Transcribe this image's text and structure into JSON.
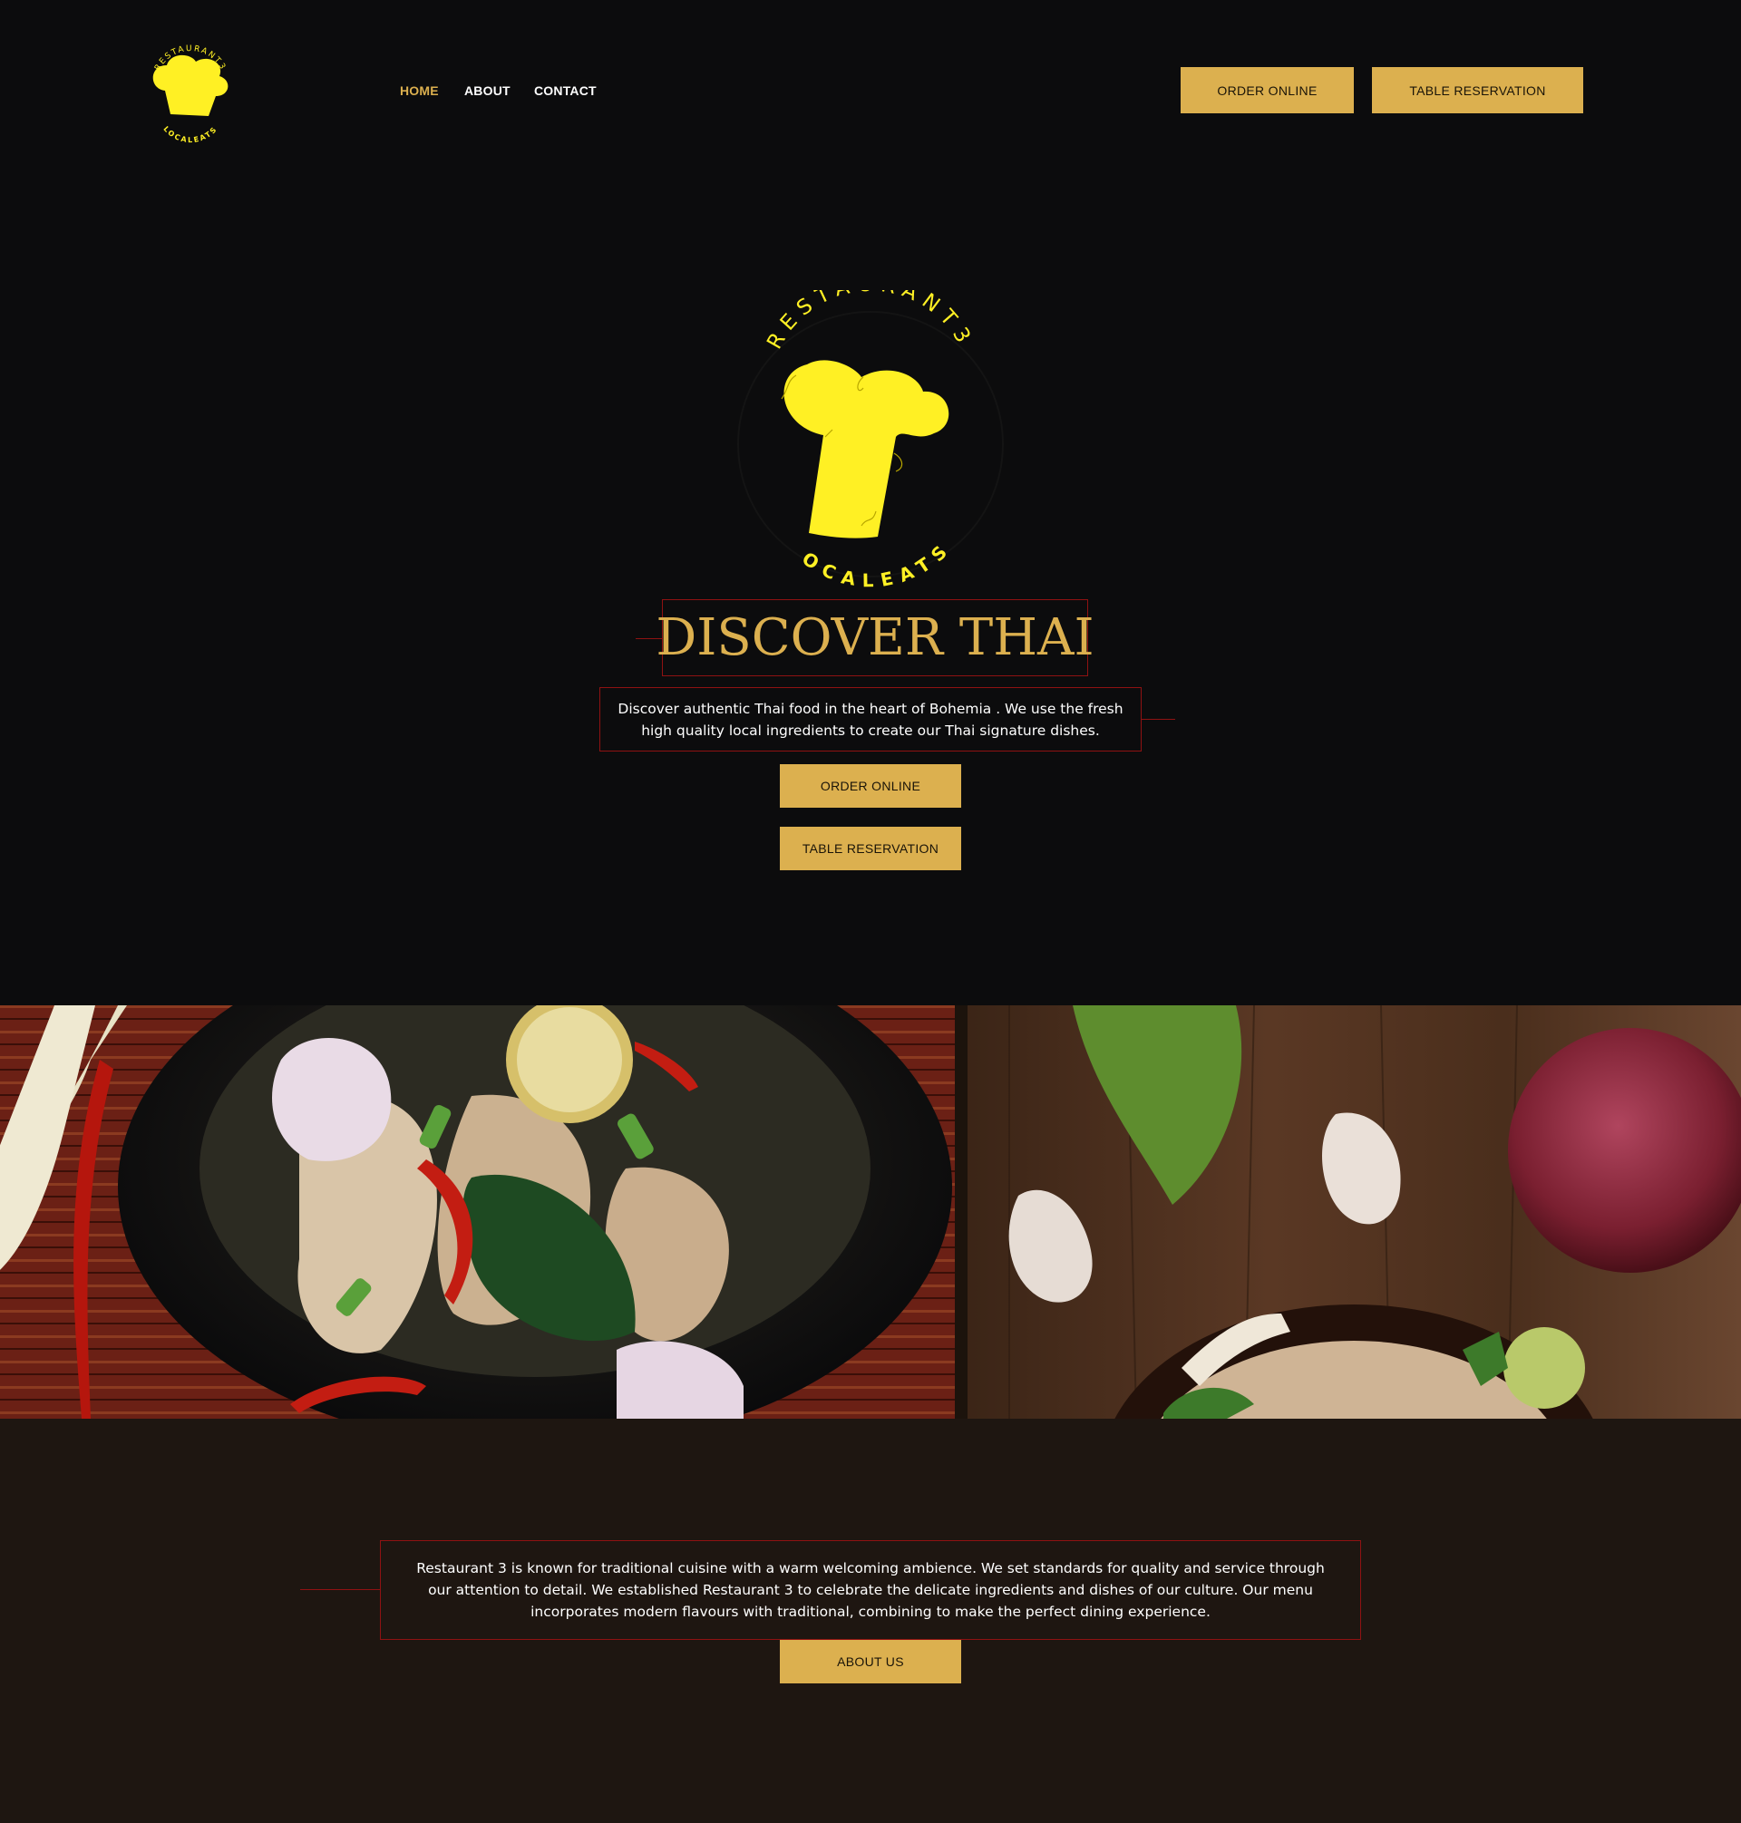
{
  "brand": {
    "arc_top": "RESTAURANT3",
    "arc_bottom": "LOCALEATS",
    "logo_color": "#fff024"
  },
  "nav": {
    "items": [
      {
        "label": "HOME",
        "active": true
      },
      {
        "label": "ABOUT",
        "active": false
      },
      {
        "label": "CONTACT",
        "active": false
      }
    ]
  },
  "header_actions": {
    "order_label": "ORDER ONLINE",
    "reservation_label": "TABLE RESERVATION"
  },
  "hero": {
    "title": "DISCOVER THAI",
    "description": "Discover authentic Thai food in the heart of Bohemia . We use the fresh high quality local ingredients to create our Thai signature dishes.",
    "order_label": "ORDER ONLINE",
    "reservation_label": "TABLE RESERVATION"
  },
  "about": {
    "text": "Restaurant 3 is known for traditional cuisine with a warm welcoming ambience. We set standards for quality and service through our attention to detail. We established Restaurant 3 to celebrate the delicate ingredients and dishes of our culture. Our menu incorporates modern flavours with traditional, combining to make the perfect dining experience.",
    "button_label": "ABOUT US"
  },
  "colors": {
    "accent_gold": "#dcb04f",
    "border_red": "#8f1212",
    "page_bg": "#0c0c0d",
    "about_bg": "#1e1611"
  }
}
